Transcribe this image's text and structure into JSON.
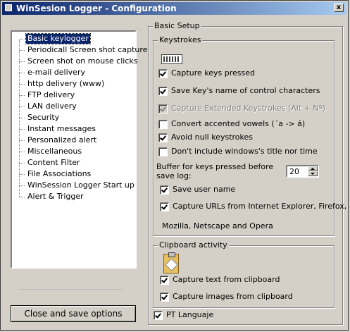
{
  "window": {
    "title": "WinSesion Logger - Configuration",
    "close_label": "x"
  },
  "tree": {
    "items": [
      {
        "label": "Basic keylogger",
        "selected": true
      },
      {
        "label": "Periodicall Screen shot capture"
      },
      {
        "label": "Screen shot on mouse clicks"
      },
      {
        "label": "e-mail delivery"
      },
      {
        "label": "http delivery (www)"
      },
      {
        "label": "FTP delivery"
      },
      {
        "label": "LAN delivery"
      },
      {
        "label": "Security"
      },
      {
        "label": "Instant messages"
      },
      {
        "label": "Personalized alert"
      },
      {
        "label": "Miscellaneous"
      },
      {
        "label": "Content Filter"
      },
      {
        "label": "File Associations"
      },
      {
        "label": "WinSession Logger Start up"
      },
      {
        "label": "Alert & Trigger"
      }
    ]
  },
  "close_button_label": "Close and save options",
  "basic_setup": {
    "label": "Basic Setup",
    "keystrokes": {
      "label": "Keystrokes",
      "icon": "keyboard-icon",
      "options": [
        {
          "label": "Capture keys pressed",
          "checked": true
        },
        {
          "label": "Save Key's name of control characters",
          "checked": true
        },
        {
          "label": "Capture Extended Keystrokes (Alt + Nº)",
          "checked": true,
          "disabled": true
        },
        {
          "label": "Convert accented vowels  (´a -> á)",
          "checked": false
        },
        {
          "label": "Avoid null keystrokes",
          "checked": true
        },
        {
          "label": "Don't include windows's title nor time",
          "checked": false
        }
      ],
      "buffer_label": "Buffer for keys pressed before save log:",
      "buffer_value": "20",
      "save_user_name": {
        "label": "Save user name",
        "checked": true
      },
      "capture_urls": {
        "label": "Capture URLs from Internet Explorer, Firefox,",
        "checked": true
      },
      "capture_urls_cont": "Mozilla, Netscape and Opera"
    },
    "clipboard": {
      "label": "Clipboard activity",
      "icon": "clipboard-icon",
      "options": [
        {
          "label": "Capture text from clipboard",
          "checked": true
        },
        {
          "label": "Capture images from clipboard",
          "checked": true
        }
      ]
    },
    "pt_language": {
      "label": "PT Languaje",
      "checked": true
    }
  }
}
